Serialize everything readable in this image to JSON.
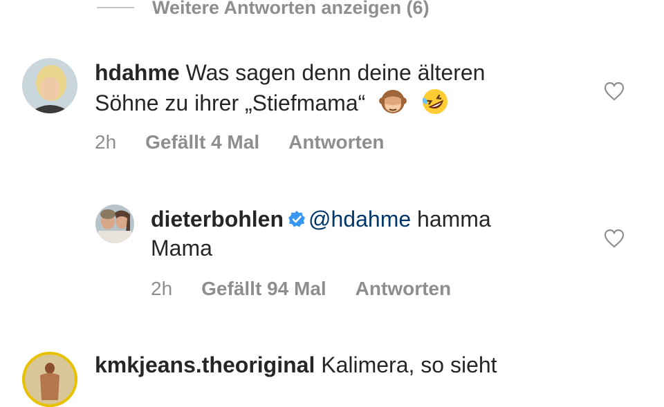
{
  "more_replies": {
    "label": "Weitere Antworten anzeigen (6)"
  },
  "comments": [
    {
      "username": "hdahme",
      "text_line1": "Was sagen denn deine älteren",
      "text_line2": "Söhne zu ihrer „Stiefmama“",
      "emojis": [
        "see-no-evil-monkey",
        "rolling-on-floor-laughing"
      ],
      "time": "2h",
      "likes": "Gefällt 4 Mal",
      "reply": "Antworten",
      "avatar_colors": {
        "bg": "#c9d6dc",
        "hair": "#e8d48b",
        "face": "#f0c9a8",
        "shirt": "#3a3a3a"
      }
    },
    {
      "username": "dieterbohlen",
      "verified": true,
      "mention": "@hdahme",
      "text_line1": " hamma",
      "text_line2": "Mama",
      "time": "2h",
      "likes": "Gefällt 94 Mal",
      "reply": "Antworten",
      "avatar_colors": {
        "bg": "#b7c4c9",
        "hair": "#5a4030",
        "face": "#d9a88a"
      }
    },
    {
      "username": "kmkjeans.theoriginal",
      "text_line1": "Kalimera, so sieht",
      "avatar_colors": {
        "bg": "#d9c79a",
        "body": "#b5754d",
        "ring": "#e6c200"
      }
    }
  ],
  "colors": {
    "text": "#262626",
    "secondary": "#8e8e8e",
    "mention": "#00376b",
    "verified": "#3897f0"
  }
}
